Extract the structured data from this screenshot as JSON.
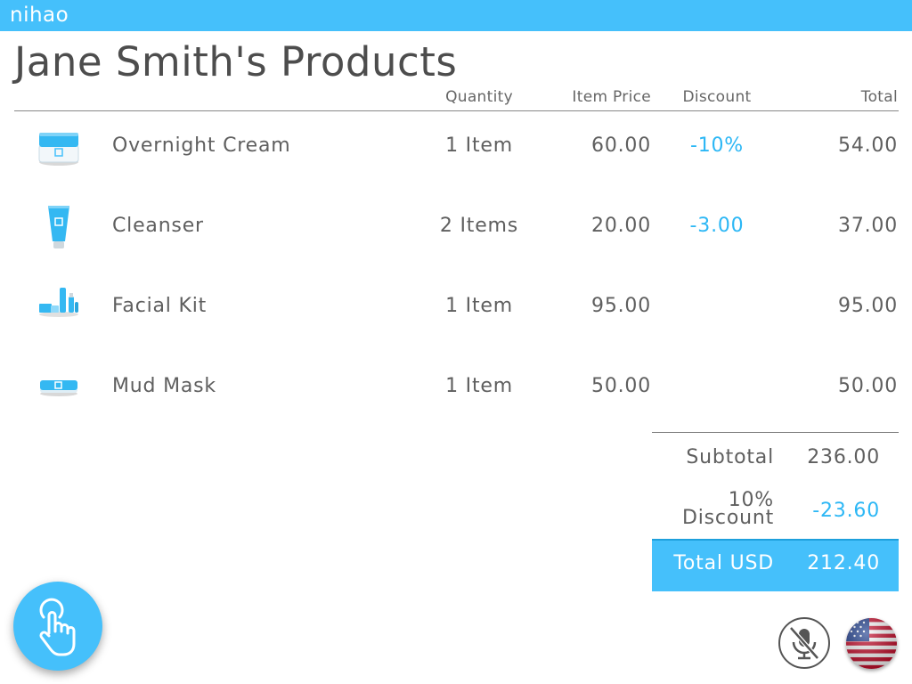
{
  "app": {
    "brand": "nihao"
  },
  "page": {
    "title": "Jane Smith's Products"
  },
  "columns": {
    "quantity": "Quantity",
    "item_price": "Item Price",
    "discount": "Discount",
    "total": "Total"
  },
  "items": [
    {
      "icon": "cream-jar-icon",
      "name": "Overnight Cream",
      "quantity": "1 Item",
      "price": "60.00",
      "discount": "-10%",
      "total": "54.00"
    },
    {
      "icon": "cleanser-tube-icon",
      "name": "Cleanser",
      "quantity": "2 Items",
      "price": "20.00",
      "discount": "-3.00",
      "total": "37.00"
    },
    {
      "icon": "facial-kit-icon",
      "name": "Facial Kit",
      "quantity": "1 Item",
      "price": "95.00",
      "discount": "",
      "total": "95.00"
    },
    {
      "icon": "mud-mask-jar-icon",
      "name": "Mud Mask",
      "quantity": "1 Item",
      "price": "50.00",
      "discount": "",
      "total": "50.00"
    }
  ],
  "summary": {
    "subtotal_label": "Subtotal",
    "subtotal_value": "236.00",
    "discount_label_line1": "10%",
    "discount_label_line2": "Discount",
    "discount_value": "-23.60",
    "total_label": "Total USD",
    "total_value": "212.40"
  },
  "controls": {
    "touch_icon": "hand-pointer-icon",
    "mic_icon": "microphone-muted-icon",
    "language_icon": "us-flag-icon"
  },
  "colors": {
    "accent": "#45c0fb",
    "discount_text": "#2cb7f5",
    "text": "#5f5f5f"
  }
}
